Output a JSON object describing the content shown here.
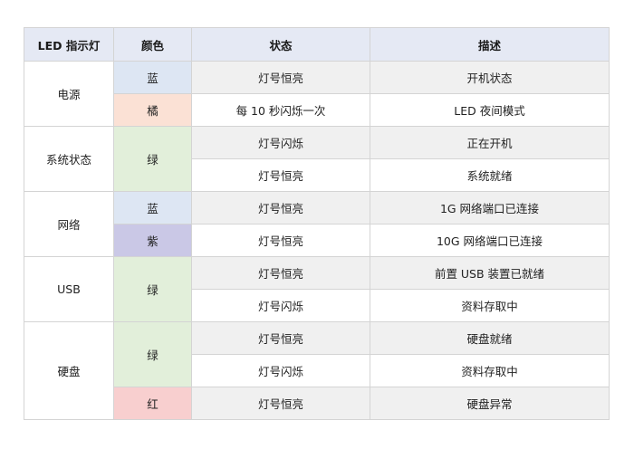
{
  "headers": [
    "LED 指示灯",
    "颜色",
    "状态",
    "描述"
  ],
  "groups": [
    {
      "name": "电源",
      "colors": [
        {
          "label": "蓝",
          "bg": "#dde6f3",
          "span": 1
        },
        {
          "label": "橘",
          "bg": "#fbe1d5",
          "span": 1
        }
      ],
      "rows": [
        {
          "status": "灯号恒亮",
          "desc": "开机状态"
        },
        {
          "status": "每 10 秒闪烁一次",
          "desc": "LED 夜间模式"
        }
      ]
    },
    {
      "name": "系统状态",
      "colors": [
        {
          "label": "绿",
          "bg": "#e2efda",
          "span": 2
        }
      ],
      "rows": [
        {
          "status": "灯号闪烁",
          "desc": "正在开机"
        },
        {
          "status": "灯号恒亮",
          "desc": "系统就绪"
        }
      ]
    },
    {
      "name": "网络",
      "colors": [
        {
          "label": "蓝",
          "bg": "#dde6f3",
          "span": 1
        },
        {
          "label": "紫",
          "bg": "#cac8e6",
          "span": 1
        }
      ],
      "rows": [
        {
          "status": "灯号恒亮",
          "desc": "1G 网络端口已连接"
        },
        {
          "status": "灯号恒亮",
          "desc": "10G 网络端口已连接"
        }
      ]
    },
    {
      "name": "USB",
      "colors": [
        {
          "label": "绿",
          "bg": "#e2efda",
          "span": 2
        }
      ],
      "rows": [
        {
          "status": "灯号恒亮",
          "desc": "前置 USB 装置已就绪"
        },
        {
          "status": "灯号闪烁",
          "desc": "资料存取中"
        }
      ]
    },
    {
      "name": "硬盘",
      "colors": [
        {
          "label": "绿",
          "bg": "#e2efda",
          "span": 2
        },
        {
          "label": "红",
          "bg": "#f8cfcf",
          "span": 1
        }
      ],
      "rows": [
        {
          "status": "灯号恒亮",
          "desc": "硬盘就绪"
        },
        {
          "status": "灯号闪烁",
          "desc": "资料存取中"
        },
        {
          "status": "灯号恒亮",
          "desc": "硬盘异常"
        }
      ]
    }
  ]
}
